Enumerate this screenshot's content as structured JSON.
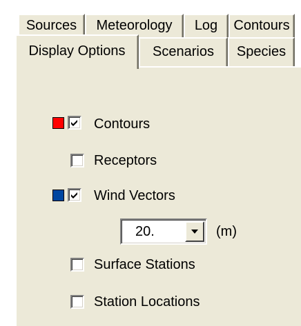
{
  "tabs": {
    "row1": [
      "Sources",
      "Meteorology",
      "Log",
      "Contours"
    ],
    "row2": [
      "Display Options",
      "Scenarios",
      "Species"
    ],
    "active": "Display Options"
  },
  "options": {
    "contours": {
      "label": "Contours",
      "checked": true,
      "color": "#ff0000"
    },
    "receptors": {
      "label": "Receptors",
      "checked": false
    },
    "wind_vectors": {
      "label": "Wind Vectors",
      "checked": true,
      "color": "#0046a0"
    },
    "wind_scale": {
      "value": "20.",
      "unit": "(m)"
    },
    "surface_stations": {
      "label": "Surface Stations",
      "checked": false
    },
    "station_locations": {
      "label": "Station Locations",
      "checked": false
    }
  }
}
